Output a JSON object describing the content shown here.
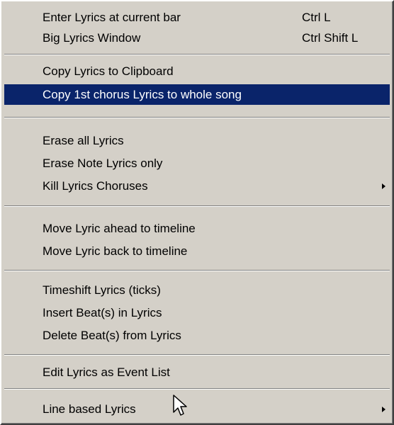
{
  "menu": {
    "items": [
      {
        "label": "Enter Lyrics at current bar",
        "shortcut": "Ctrl L"
      },
      {
        "label": "Big Lyrics Window",
        "shortcut": "Ctrl Shift L"
      },
      {
        "label": "Copy Lyrics to Clipboard",
        "shortcut": ""
      },
      {
        "label": "Copy 1st chorus Lyrics to whole song",
        "shortcut": "",
        "highlighted": true
      },
      {
        "label": "Erase all Lyrics",
        "shortcut": ""
      },
      {
        "label": "Erase Note Lyrics only",
        "shortcut": ""
      },
      {
        "label": "Kill Lyrics Choruses",
        "shortcut": "",
        "submenu": true
      },
      {
        "label": "Move Lyric ahead to timeline",
        "shortcut": ""
      },
      {
        "label": "Move Lyric back to timeline",
        "shortcut": ""
      },
      {
        "label": "Timeshift Lyrics (ticks)",
        "shortcut": ""
      },
      {
        "label": "Insert Beat(s) in Lyrics",
        "shortcut": ""
      },
      {
        "label": "Delete Beat(s) from Lyrics",
        "shortcut": ""
      },
      {
        "label": "Edit Lyrics as Event List",
        "shortcut": ""
      },
      {
        "label": "Line based Lyrics",
        "shortcut": "",
        "submenu": true
      }
    ]
  },
  "colors": {
    "menu_bg": "#d4d0c8",
    "highlight_bg": "#0a246a",
    "highlight_text": "#ffffff"
  }
}
